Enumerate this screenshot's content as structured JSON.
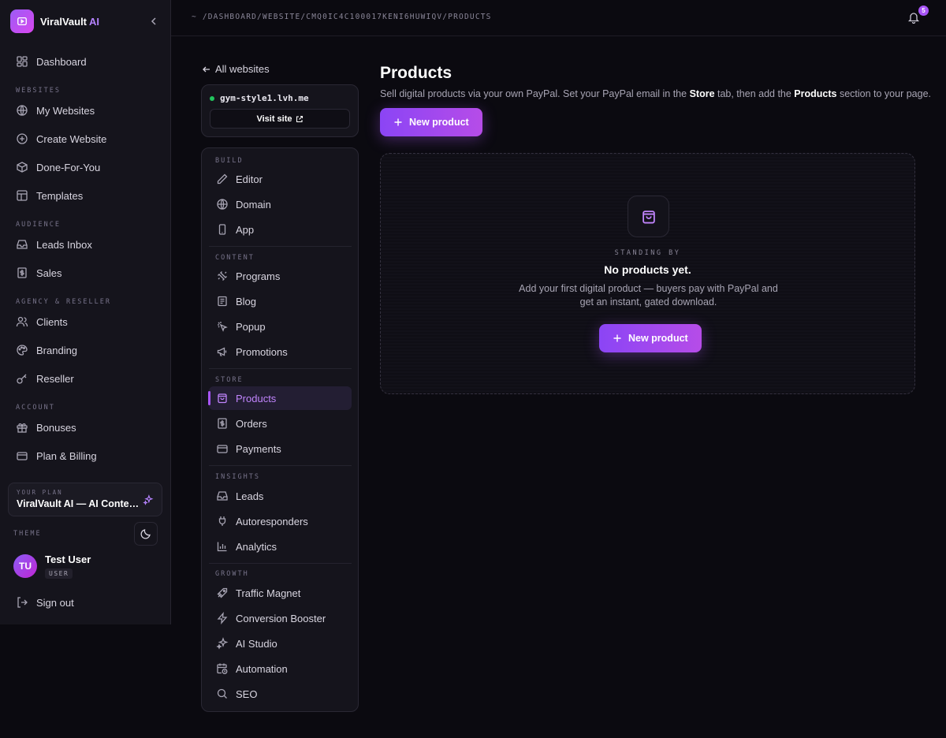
{
  "app": {
    "name": "ViralVault",
    "name_suffix": "AI"
  },
  "sidebar": {
    "dashboard": "Dashboard",
    "sections": {
      "websites": "WEBSITES",
      "audience": "AUDIENCE",
      "agency": "AGENCY & RESELLER",
      "account": "ACCOUNT"
    },
    "items": {
      "my_websites": "My Websites",
      "create_website": "Create Website",
      "done_for_you": "Done-For-You",
      "templates": "Templates",
      "leads_inbox": "Leads Inbox",
      "sales": "Sales",
      "clients": "Clients",
      "branding": "Branding",
      "reseller": "Reseller",
      "bonuses": "Bonuses",
      "plan_billing": "Plan & Billing"
    },
    "plan": {
      "label": "YOUR PLAN",
      "name": "ViralVault AI — AI Content Suite"
    },
    "theme_label": "THEME",
    "user": {
      "initials": "TU",
      "name": "Test User",
      "role": "USER"
    },
    "signout": "Sign out"
  },
  "topbar": {
    "breadcrumb": "~ /DASHBOARD/WEBSITE/CMQ0IC4C100017KENI6HUWIQV/PRODUCTS",
    "notifications": "5"
  },
  "site": {
    "back": "All websites",
    "domain": "gym-style1.lvh.me",
    "visit": "Visit site",
    "status_color": "#22c55e"
  },
  "menu": {
    "sections": {
      "build": "BUILD",
      "content": "CONTENT",
      "store": "STORE",
      "insights": "INSIGHTS",
      "growth": "GROWTH"
    },
    "items": {
      "editor": "Editor",
      "domain": "Domain",
      "app": "App",
      "programs": "Programs",
      "blog": "Blog",
      "popup": "Popup",
      "promotions": "Promotions",
      "products": "Products",
      "orders": "Orders",
      "payments": "Payments",
      "leads": "Leads",
      "autoresponders": "Autoresponders",
      "analytics": "Analytics",
      "traffic_magnet": "Traffic Magnet",
      "conversion_booster": "Conversion Booster",
      "ai_studio": "AI Studio",
      "automation": "Automation",
      "seo": "SEO"
    },
    "active": "products"
  },
  "main": {
    "title": "Products",
    "subtitle": {
      "part1": "Sell digital products via your own PayPal. Set your PayPal email in the ",
      "store": "Store",
      "part2": " tab, then add the ",
      "products": "Products",
      "part3": " section to your page."
    },
    "new_product": "New product",
    "empty": {
      "kicker": "STANDING BY",
      "title": "No products yet.",
      "desc": "Add your first digital product — buyers pay with PayPal and get an instant, gated download.",
      "button": "New product"
    }
  },
  "colors": {
    "accent": "#a855f7",
    "accent_text": "#c084fc",
    "background": "#0b0a10",
    "panel": "#15141c"
  }
}
